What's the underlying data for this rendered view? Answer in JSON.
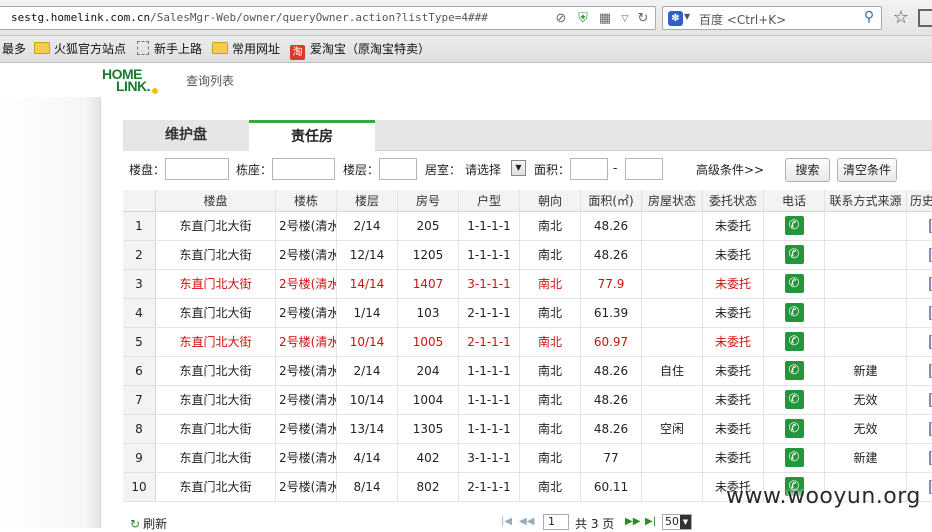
{
  "browser": {
    "url_host": "sestg.homelink.com.cn",
    "url_path": "/SalesMgr-Web/owner/queryOwner.action?listType=4###",
    "search_placeholder": "百度 <Ctrl+K>",
    "search_engine_icon": "paw-icon"
  },
  "bookmarks": [
    {
      "label": "最多",
      "icon": "none"
    },
    {
      "label": "火狐官方站点",
      "icon": "folder-icon"
    },
    {
      "label": "新手上路",
      "icon": "page-icon"
    },
    {
      "label": "常用网址",
      "icon": "folder-icon"
    },
    {
      "label": "爱淘宝（原淘宝特卖）",
      "icon": "taobao-icon"
    }
  ],
  "site": {
    "logo_line1": "HOME",
    "logo_line2": "LINK.",
    "header_title": "查询列表"
  },
  "tabs": [
    {
      "label": "维护盘",
      "active": false
    },
    {
      "label": "责任房",
      "active": true
    }
  ],
  "filters": {
    "estate_label": "楼盘：",
    "building_label": "栋座：",
    "floor_label": "楼层：",
    "rooms_label": "居室：",
    "rooms_selected": "请选择",
    "area_label": "面积：",
    "area_sep": "-",
    "advanced_label": "高级条件>>",
    "search_button": "搜索",
    "clear_button": "清空条件"
  },
  "table": {
    "columns": [
      "",
      "楼盘",
      "楼栋",
      "楼层",
      "房号",
      "户型",
      "朝向",
      "面积(㎡)",
      "房屋状态",
      "委托状态",
      "电话",
      "联系方式来源",
      "历史"
    ],
    "rows": [
      {
        "n": "1",
        "estate": "东直门北大街",
        "building": "2号楼(清水",
        "floor": "2/14",
        "room": "205",
        "layout": "1-1-1-1",
        "orient": "南北",
        "area": "48.26",
        "house_status": "",
        "entrust": "未委托",
        "source": "",
        "warn": false
      },
      {
        "n": "2",
        "estate": "东直门北大街",
        "building": "2号楼(清水",
        "floor": "12/14",
        "room": "1205",
        "layout": "1-1-1-1",
        "orient": "南北",
        "area": "48.26",
        "house_status": "",
        "entrust": "未委托",
        "source": "",
        "warn": false
      },
      {
        "n": "3",
        "estate": "东直门北大街",
        "building": "2号楼(清水",
        "floor": "14/14",
        "room": "1407",
        "layout": "3-1-1-1",
        "orient": "南北",
        "area": "77.9",
        "house_status": "",
        "entrust": "未委托",
        "source": "",
        "warn": true
      },
      {
        "n": "4",
        "estate": "东直门北大街",
        "building": "2号楼(清水",
        "floor": "1/14",
        "room": "103",
        "layout": "2-1-1-1",
        "orient": "南北",
        "area": "61.39",
        "house_status": "",
        "entrust": "未委托",
        "source": "",
        "warn": false
      },
      {
        "n": "5",
        "estate": "东直门北大街",
        "building": "2号楼(清水",
        "floor": "10/14",
        "room": "1005",
        "layout": "2-1-1-1",
        "orient": "南北",
        "area": "60.97",
        "house_status": "",
        "entrust": "未委托",
        "source": "",
        "warn": true
      },
      {
        "n": "6",
        "estate": "东直门北大街",
        "building": "2号楼(清水",
        "floor": "2/14",
        "room": "204",
        "layout": "1-1-1-1",
        "orient": "南北",
        "area": "48.26",
        "house_status": "自住",
        "entrust": "未委托",
        "source": "新建",
        "warn": false
      },
      {
        "n": "7",
        "estate": "东直门北大街",
        "building": "2号楼(清水",
        "floor": "10/14",
        "room": "1004",
        "layout": "1-1-1-1",
        "orient": "南北",
        "area": "48.26",
        "house_status": "",
        "entrust": "未委托",
        "source": "无效",
        "warn": false
      },
      {
        "n": "8",
        "estate": "东直门北大街",
        "building": "2号楼(清水",
        "floor": "13/14",
        "room": "1305",
        "layout": "1-1-1-1",
        "orient": "南北",
        "area": "48.26",
        "house_status": "空闲",
        "entrust": "未委托",
        "source": "无效",
        "warn": false
      },
      {
        "n": "9",
        "estate": "东直门北大街",
        "building": "2号楼(清水",
        "floor": "4/14",
        "room": "402",
        "layout": "3-1-1-1",
        "orient": "南北",
        "area": "77",
        "house_status": "",
        "entrust": "未委托",
        "source": "新建",
        "warn": false
      },
      {
        "n": "10",
        "estate": "东直门北大街",
        "building": "2号楼(清水",
        "floor": "8/14",
        "room": "802",
        "layout": "2-1-1-1",
        "orient": "南北",
        "area": "60.11",
        "house_status": "",
        "entrust": "未委托",
        "source": "",
        "warn": false
      }
    ],
    "warn_color": "#d01010",
    "phone_icon": "phone-icon",
    "history_icon": "document-icon"
  },
  "pager": {
    "refresh_label": "刷新",
    "current_page": "1",
    "total_label": "共 3 页",
    "page_size": "50"
  },
  "watermark": "www.wooyun.org"
}
